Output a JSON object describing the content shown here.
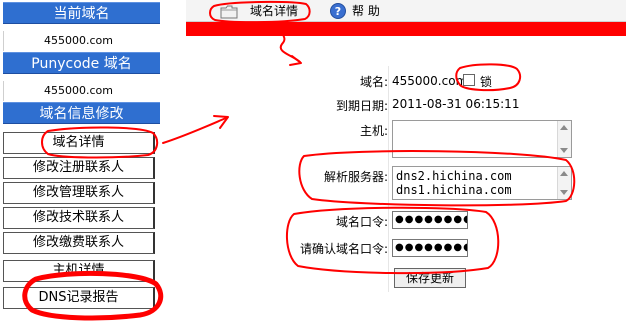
{
  "sidebar": {
    "current_domain_header": "当前域名",
    "current_domain_value": "455000.com",
    "punycode_header": "Punycode 域名",
    "punycode_value": "455000.com",
    "modify_header": "域名信息修改",
    "items": [
      {
        "label": "域名详情"
      },
      {
        "label": "修改注册联系人"
      },
      {
        "label": "修改管理联系人"
      },
      {
        "label": "修改技术联系人"
      },
      {
        "label": "修改缴费联系人"
      },
      {
        "label": "主机详情"
      },
      {
        "label": "DNS记录报告"
      }
    ]
  },
  "toolbar": {
    "details_label": "域名详情",
    "help_label": "帮 助"
  },
  "form": {
    "domain_label": "域名:",
    "domain_value": "455000.com",
    "lock_label": "锁",
    "expiry_label": "到期日期:",
    "expiry_value": "2011-08-31 06:15:11",
    "host_label": "主机:",
    "dns_label": "解析服务器:",
    "dns_servers": [
      "dns2.hichina.com",
      "dns1.hichina.com"
    ],
    "password_label": "域名口令:",
    "password_value": "●●●●●●●●●",
    "confirm_label": "请确认域名口令:",
    "confirm_value": "●●●●●●●●●",
    "save_button": "保存更新"
  },
  "colors": {
    "sidebar_header": "#2f6fd0",
    "red_bar": "#ff0000",
    "annotation": "#ff0000"
  }
}
